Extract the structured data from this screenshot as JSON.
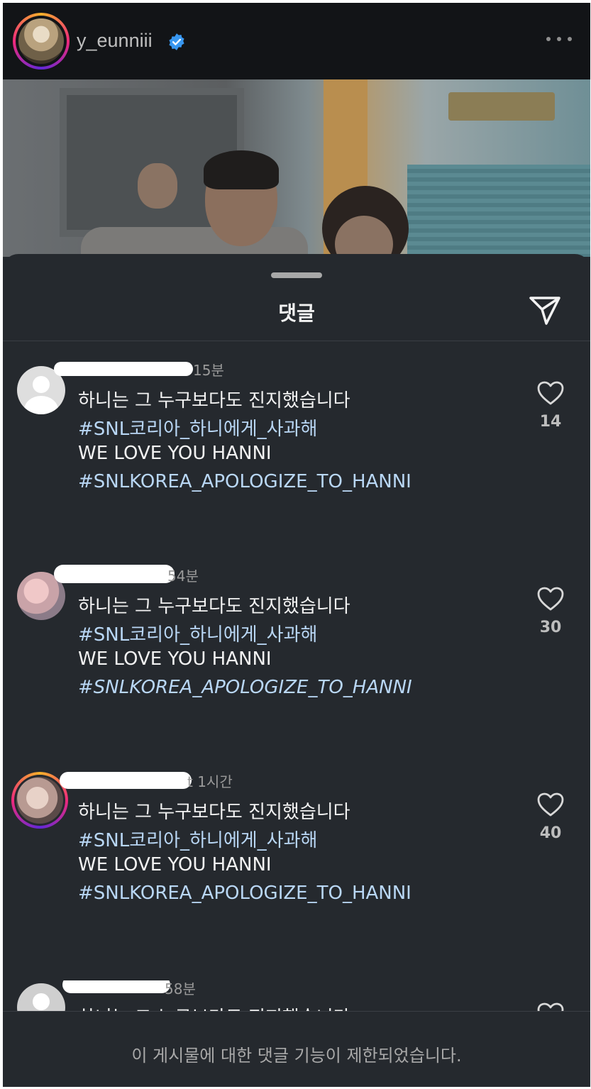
{
  "post": {
    "username": "y_eunniii",
    "verified_icon": "verified-badge-icon",
    "more_icon": "more-dots-icon"
  },
  "sheet": {
    "title": "댓글",
    "share_icon": "send-icon"
  },
  "comments": [
    {
      "time": "15분",
      "lines": [
        "하니는 그 누구보다도 진지했습니다",
        "#SNL코리아_하니에게_사과해",
        "WE LOVE YOU HANNI",
        "#SNLKOREA_APOLOGIZE_TO_HANNI"
      ],
      "likes": "14"
    },
    {
      "time": "54분",
      "lines": [
        "하니는 그 누구보다도 진지했습니다",
        "#SNL코리아_하니에게_사과해",
        "WE LOVE YOU HANNI",
        "#SNLKOREA_APOLOGIZE_TO_HANNI"
      ],
      "likes": "30"
    },
    {
      "time": "t 1시간",
      "lines": [
        "하니는 그 누구보다도 진지했습니다",
        "#SNL코리아_하니에게_사과해",
        "WE LOVE YOU HANNI",
        "#SNLKOREA_APOLOGIZE_TO_HANNI"
      ],
      "likes": "40"
    },
    {
      "time": "58분",
      "lines": [
        "하니는 그 누구보다도 진지했습니다"
      ],
      "likes": ""
    }
  ],
  "footer": {
    "restricted_text": "이 게시물에 대한 댓글 기능이 제한되었습니다."
  },
  "colors": {
    "background": "#25292e",
    "header": "#121417",
    "hashtag": "#b9d7f5",
    "muted": "#9a9a9a"
  }
}
